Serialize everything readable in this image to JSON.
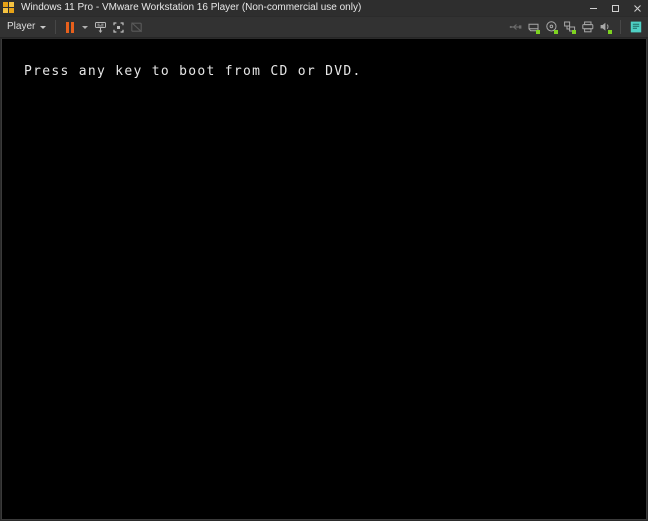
{
  "window": {
    "title": "Windows 11 Pro - VMware Workstation 16 Player (Non-commercial use only)",
    "app_icon": "vmware-player-icon",
    "controls": {
      "minimize_label": "Minimize",
      "maximize_label": "Maximize",
      "close_label": "Close"
    }
  },
  "toolbar": {
    "player_menu_label": "Player",
    "buttons": [
      {
        "name": "pause-button",
        "label": "Pause",
        "icon": "pause-icon",
        "state": "enabled"
      },
      {
        "name": "power-dropdown-button",
        "label": "Power options",
        "icon": "chevron-down-icon",
        "state": "enabled"
      },
      {
        "name": "send-ctrl-alt-del-button",
        "label": "Send Ctrl+Alt+Del",
        "icon": "ctrl-alt-del-icon",
        "state": "enabled"
      },
      {
        "name": "enter-fullscreen-button",
        "label": "Enter full screen",
        "icon": "fullscreen-icon",
        "state": "enabled"
      },
      {
        "name": "unity-mode-button",
        "label": "Unity mode",
        "icon": "unity-mode-icon",
        "state": "disabled"
      }
    ],
    "status_devices": [
      {
        "name": "usb-device-icon",
        "label": "USB devices",
        "status": "disconnected",
        "has_dot": false
      },
      {
        "name": "hard-disk-icon",
        "label": "Hard disk",
        "status": "connected",
        "has_dot": true
      },
      {
        "name": "cd-dvd-icon",
        "label": "CD/DVD drive",
        "status": "connected",
        "has_dot": true
      },
      {
        "name": "network-adapter-icon",
        "label": "Network adapter",
        "status": "connected",
        "has_dot": true
      },
      {
        "name": "printer-icon",
        "label": "Printer",
        "status": "connected",
        "has_dot": false
      },
      {
        "name": "sound-card-icon",
        "label": "Sound card",
        "status": "connected",
        "has_dot": true
      }
    ],
    "notes_button": {
      "name": "vm-notes-icon",
      "label": "Virtual machine notes",
      "color": "#4fd1c5"
    }
  },
  "vm_screen": {
    "background_color": "#000000",
    "boot_prompt": "Press any key to boot from CD or DVD."
  }
}
